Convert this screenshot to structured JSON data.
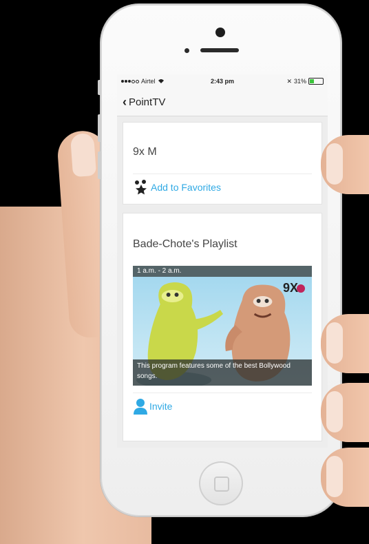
{
  "status_bar": {
    "carrier": "Airtel",
    "time": "2:43 pm",
    "battery_text": "31%",
    "battery_level": 0.31
  },
  "nav": {
    "back_label": "PointTV"
  },
  "channel": {
    "name": "9x M",
    "favorites_label": "Add to Favorites",
    "favorites_icon": "add-favorites-icon"
  },
  "playlist": {
    "title": "Bade-Chote's Playlist",
    "time_slot": "1 a.m. - 2 a.m.",
    "description": "This program features some of the best Bollywood songs.",
    "logo_text": "9X",
    "invite_label": "Invite",
    "invite_icon": "person-icon"
  },
  "colors": {
    "accent": "#2fa9e4",
    "battery_green": "#3bc43b",
    "logo_magenta": "#c0245b"
  }
}
